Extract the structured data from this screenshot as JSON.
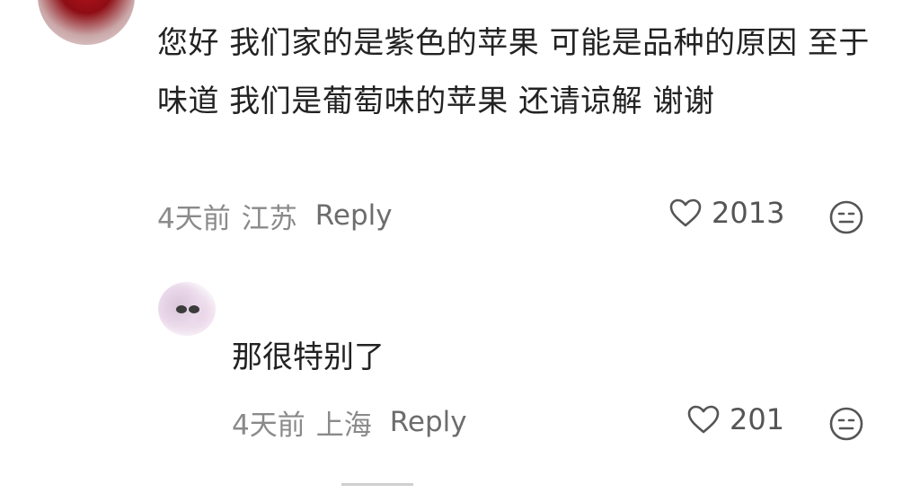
{
  "comment": {
    "text": "您好 我们家的是紫色的苹果 可能是品种的原因 至于味道 我们是葡萄味的苹果 还请谅解 谢谢",
    "time": "4天前",
    "location": "江苏",
    "reply_label": "Reply",
    "likes": "2013"
  },
  "reply": {
    "text": "那很特别了",
    "time": "4天前",
    "location": "上海",
    "reply_label": "Reply",
    "likes": "201"
  },
  "icons": {
    "like": "heart-outline",
    "reaction": "emoji-face"
  }
}
